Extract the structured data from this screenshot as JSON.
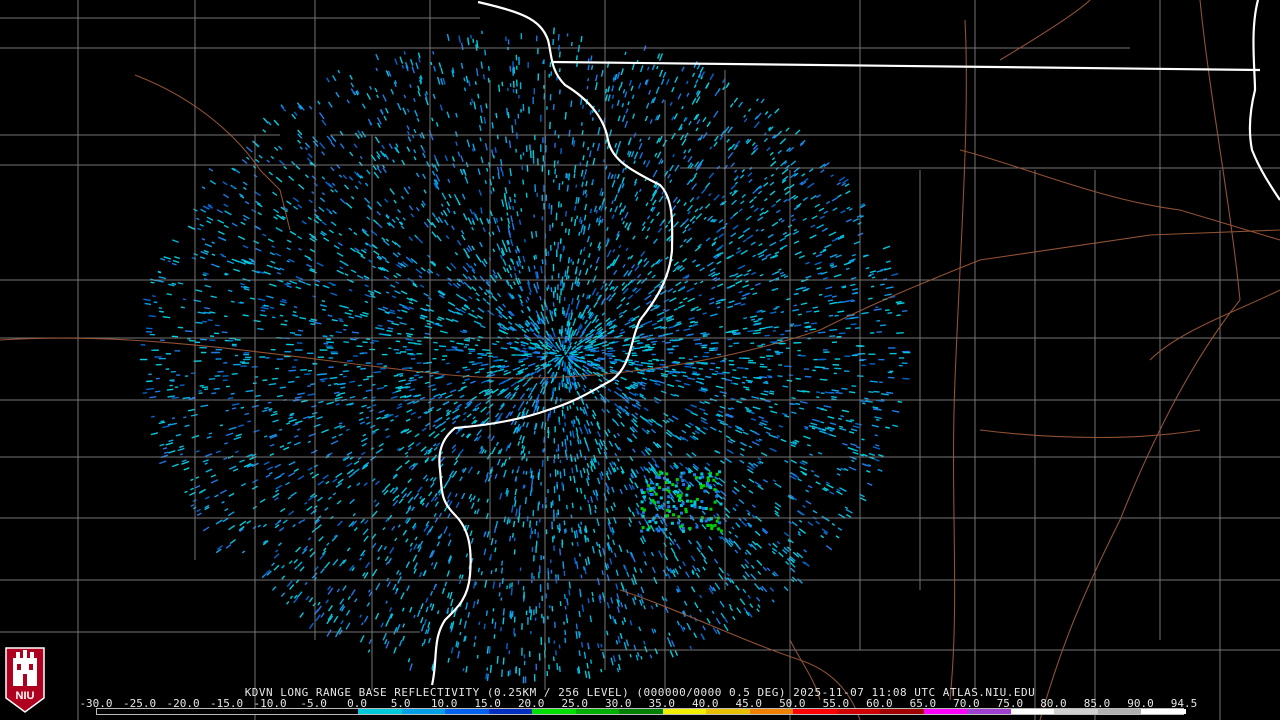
{
  "caption": "KDVN LONG RANGE BASE REFLECTIVITY (0.25KM / 256 LEVEL) (000000/0000 0.5 DEG) 2025-11-07 11:08 UTC  ATLAS.NIU.EDU",
  "logo_text": "NIU",
  "colors": {
    "background": "#000000",
    "county_lines": "#8a8a8a",
    "highways": "#a05a3a",
    "state_border": "#ffffff"
  },
  "scale": {
    "labels": [
      "-30.0",
      "-25.0",
      "-20.0",
      "-15.0",
      "-10.0",
      "-5.0",
      "0.0",
      "5.0",
      "10.0",
      "15.0",
      "20.0",
      "25.0",
      "30.0",
      "35.0",
      "40.0",
      "45.0",
      "50.0",
      "55.0",
      "60.0",
      "65.0",
      "70.0",
      "75.0",
      "80.0",
      "85.0",
      "90.0",
      "94.5"
    ],
    "colors": [
      "#000000",
      "#000000",
      "#000000",
      "#000000",
      "#000000",
      "#000000",
      "#00c8d8",
      "#00a0e8",
      "#0060f0",
      "#0030c0",
      "#00e000",
      "#00b000",
      "#008000",
      "#f0f000",
      "#e8c000",
      "#f08000",
      "#ff0000",
      "#d00000",
      "#a00000",
      "#ff00ff",
      "#a040d0",
      "#ffffff",
      "#d0d0d0",
      "#b0b0b0",
      "#ffffff"
    ]
  }
}
